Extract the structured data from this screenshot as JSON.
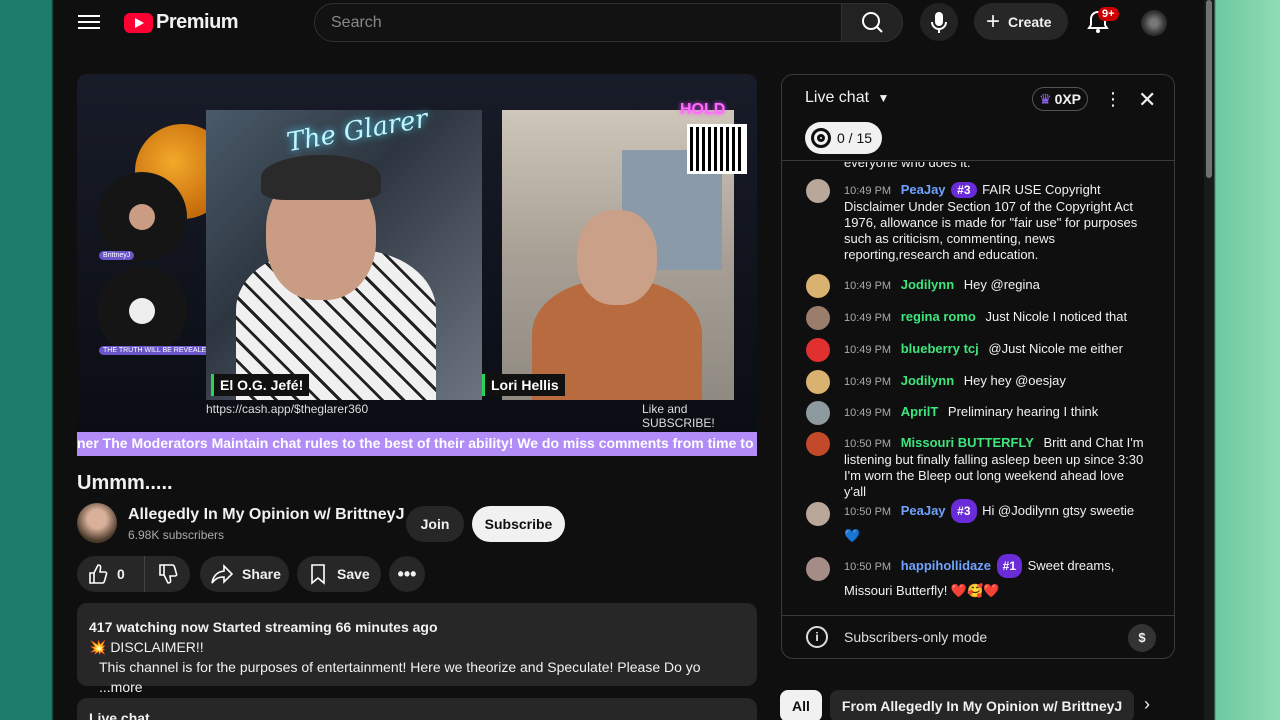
{
  "header": {
    "brand": "Premium",
    "search_placeholder": "Search",
    "create_label": "Create",
    "notifications_badge": "9+"
  },
  "video": {
    "title": "Ummm.....",
    "guest_name": "El O.G. Jefé!",
    "host_name": "Lori Hellis",
    "cashapp": "https://cash.app/$theglarer360",
    "like_subscribe": "Like and SUBSCRIBE!",
    "neon_sign": "The Glarer",
    "hold_text": "HOLD",
    "ticker": "ner The Moderators Maintain chat rules to the best of their ability! We do miss comments from time to time l",
    "side_label_1": "BrittneyJ",
    "side_label_2": "THE TRUTH WILL BE REVEALED"
  },
  "channel": {
    "name": "Allegedly In My Opinion w/ BrittneyJ",
    "subscribers": "6.98K subscribers",
    "join_label": "Join",
    "subscribe_label": "Subscribe"
  },
  "actions": {
    "likes": "0",
    "share_label": "Share",
    "save_label": "Save"
  },
  "description": {
    "meta": "417 watching now  Started streaming 66 minutes ago",
    "line1": "💥 DISCLAIMER!!",
    "line2": "This channel is for the purposes of entertainment!  Here we theorize and Speculate!  Please Do yo",
    "more": "...more"
  },
  "below_stub": "Live chat",
  "chat": {
    "title": "Live chat",
    "xp": "0XP",
    "goal": "0 / 15",
    "partial_top": "everyone who does it.",
    "messages": [
      {
        "time": "10:49 PM",
        "author": "PeaJay",
        "rank": "#3",
        "text": "FAIR USE Copyright Disclaimer Under Section 107 of the Copyright Act 1976, allowance is made for \"fair use\" for purposes such as criticism, commenting, news reporting,research and education.",
        "color": "#6fa3ff"
      },
      {
        "time": "10:49 PM",
        "author": "Jodilynn",
        "rank": "",
        "text": "Hey @regina",
        "color": "#3ee57d"
      },
      {
        "time": "10:49 PM",
        "author": "regina romo",
        "rank": "",
        "text": "Just Nicole I noticed that",
        "color": "#3ee57d"
      },
      {
        "time": "10:49 PM",
        "author": "blueberry tcj",
        "rank": "",
        "text": "@Just Nicole me either",
        "color": "#3ee57d"
      },
      {
        "time": "10:49 PM",
        "author": "Jodilynn",
        "rank": "",
        "text": "Hey hey @oesjay",
        "color": "#3ee57d"
      },
      {
        "time": "10:49 PM",
        "author": "AprilT",
        "rank": "",
        "text": "Preliminary hearing I think",
        "color": "#3ee57d"
      },
      {
        "time": "10:50 PM",
        "author": "Missouri BUTTERFLY",
        "rank": "",
        "text": "Britt and Chat I'm listening but finally falling asleep been up since 3:30 I'm worn the Bleep out long weekend ahead love y'all",
        "color": "#3ee57d"
      },
      {
        "time": "10:50 PM",
        "author": "PeaJay",
        "rank": "#3",
        "text": "Hi @Jodilynn gtsy sweetie 💙",
        "color": "#6fa3ff"
      },
      {
        "time": "10:50 PM",
        "author": "happihollidaze",
        "rank": "#1",
        "text": "Sweet dreams, Missouri Butterfly! ❤️🥰❤️",
        "color": "#6fa3ff"
      }
    ],
    "footer_label": "Subscribers-only mode"
  },
  "chips": [
    "All",
    "From Allegedly In My Opinion w/ BrittneyJ"
  ]
}
